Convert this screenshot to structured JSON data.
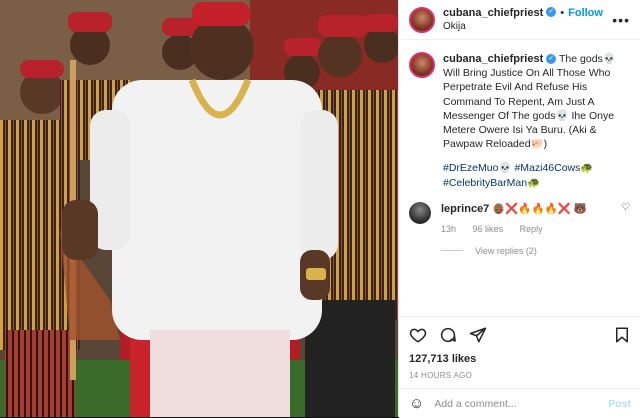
{
  "post": {
    "username": "cubana_chiefpriest",
    "follow_label": "Follow",
    "location": "Okija",
    "more_label": "•••"
  },
  "caption": {
    "username": "cubana_chiefpriest",
    "text": "The gods💀 Will Bring Justice On All Those Who Perpetrate Evil And Refuse His Command To Repent, Am Just A Messenger Of The gods💀 Ihe Onye Metere Owere Isi Ya Buru. (Aki & Pawpaw Reloaded🐖)",
    "hashtags": [
      "#DrEzeMuo💀",
      "#Mazi46Cows🐢",
      "#CelebrityBarMan🐢"
    ]
  },
  "comment": {
    "username": "leprince7",
    "text": "👴🏾❌🔥🔥🔥❌ 🐻",
    "time": "13h",
    "likes": "96 likes",
    "reply_label": "Reply",
    "view_replies": "View replies (2)"
  },
  "actions": {
    "likes": "127,713 likes",
    "time_ago": "14 HOURS AGO"
  },
  "add_comment": {
    "placeholder": "Add a comment...",
    "post_label": "Post"
  }
}
